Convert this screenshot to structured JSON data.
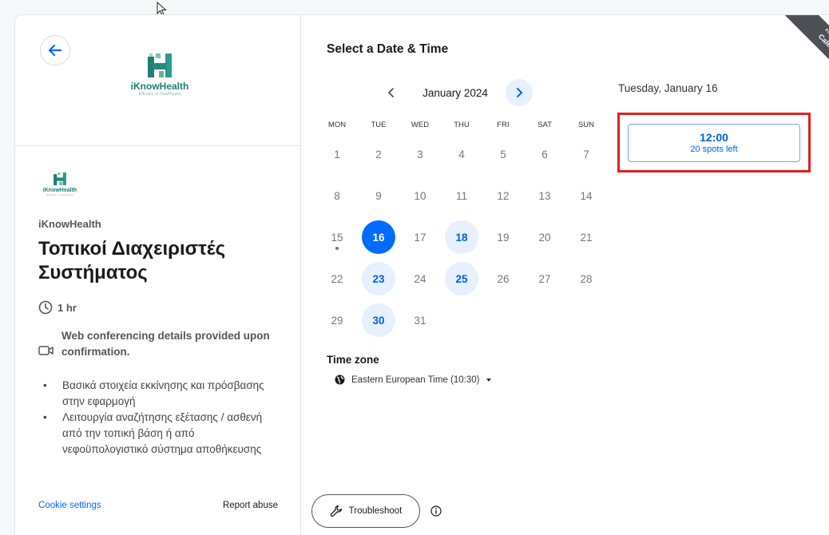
{
  "brand": {
    "name": "iKnowHealth",
    "tagline": "Efficacy in Healthcare",
    "color": "#1f7f73"
  },
  "event": {
    "organizer": "iKnowHealth",
    "title": "Τοπικοί Διαχειριστές Συστήματος",
    "duration": "1 hr",
    "conferencing": "Web conferencing details provided upon confirmation.",
    "description": [
      "Βασικά στοιχεία εκκίνησης και πρόσβασης στην εφαρμογή",
      "Λειτουργία αναζήτησης εξέτασης / ασθενή από την τοπική βάση ή από νεφοϋπολογιστικό σύστημα αποθήκευσης"
    ]
  },
  "footer": {
    "cookie_settings": "Cookie settings",
    "report_abuse": "Report abuse"
  },
  "scheduler": {
    "title": "Select a Date & Time",
    "month": "January 2024",
    "weekdays": [
      "MON",
      "TUE",
      "WED",
      "THU",
      "FRI",
      "SAT",
      "SUN"
    ],
    "weeks": [
      [
        {
          "d": "1"
        },
        {
          "d": "2"
        },
        {
          "d": "3"
        },
        {
          "d": "4"
        },
        {
          "d": "5"
        },
        {
          "d": "6"
        },
        {
          "d": "7"
        }
      ],
      [
        {
          "d": "8"
        },
        {
          "d": "9"
        },
        {
          "d": "10"
        },
        {
          "d": "11"
        },
        {
          "d": "12"
        },
        {
          "d": "13"
        },
        {
          "d": "14"
        }
      ],
      [
        {
          "d": "15",
          "today": true
        },
        {
          "d": "16",
          "state": "selected"
        },
        {
          "d": "17"
        },
        {
          "d": "18",
          "state": "available"
        },
        {
          "d": "19"
        },
        {
          "d": "20"
        },
        {
          "d": "21"
        }
      ],
      [
        {
          "d": "22"
        },
        {
          "d": "23",
          "state": "available"
        },
        {
          "d": "24"
        },
        {
          "d": "25",
          "state": "available"
        },
        {
          "d": "26"
        },
        {
          "d": "27"
        },
        {
          "d": "28"
        }
      ],
      [
        {
          "d": "29"
        },
        {
          "d": "30",
          "state": "available"
        },
        {
          "d": "31"
        }
      ]
    ],
    "timezone_label": "Time zone",
    "timezone_value": "Eastern European Time (10:30)",
    "selected_day": "Tuesday, January 16",
    "slot": {
      "time": "12:00",
      "spots": "20 spots left"
    },
    "troubleshoot": "Troubleshoot"
  },
  "ribbon": {
    "line1": "POWERED BY",
    "line2": "Calendly"
  },
  "colors": {
    "primary": "#006bff",
    "available_bg": "#e6f0ff",
    "highlight": "#e02020"
  }
}
